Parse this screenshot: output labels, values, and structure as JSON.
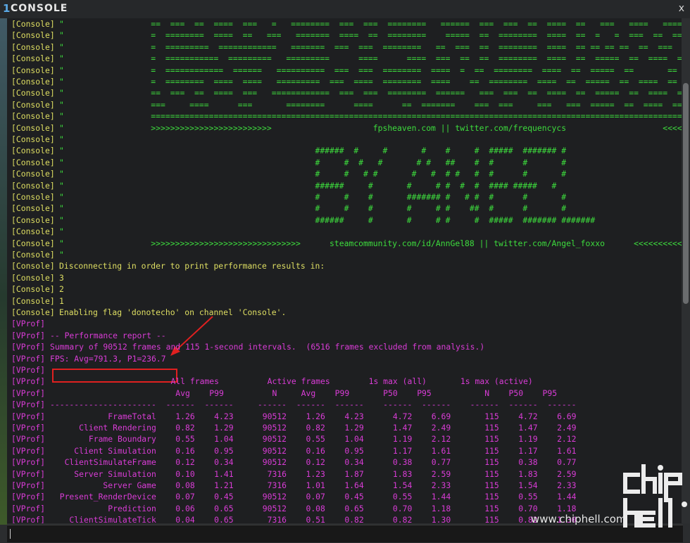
{
  "window": {
    "number": "1",
    "title": "CONSOLE",
    "close_label": "x"
  },
  "colors": {
    "console": "#dede62",
    "banner": "#3ddc3d",
    "vprof": "#d93cd6",
    "highlight": "#e02020",
    "background": "#1e1f21"
  },
  "prefixes": {
    "console": "[Console]",
    "vprof": "[VProf]"
  },
  "console_lines": [
    {
      "prefix": "[Console]",
      "text": "\"                  ==  ===  ==  ====  ===   =   ========  ===  ===  ========   ======  ===  ===  ==  ====  ==   ===   ====   ====",
      "color": "g"
    },
    {
      "prefix": "[Console]",
      "text": "\"                  =  ========  ====  ==   ===   =======  ====  ==  ========    =====  ==  ========  ====  ==  =   =  ===  ==  ===",
      "color": "g"
    },
    {
      "prefix": "[Console]",
      "text": "\"                  =  =========  ============   =======  ===  ===  ========   ==  ===  ==  ========  ====  == == == ==  ==  ===",
      "color": "g"
    },
    {
      "prefix": "[Console]",
      "text": "\"                  =  ===========  =========   =========      ====      ====  ===  ==  ==  ========  ====  ==  =====  ==  ====  ==",
      "color": "g"
    },
    {
      "prefix": "[Console]",
      "text": "\"                  =  ============  ======   ==========  ===  ===  ========  ====  =  ==  ========  ====  ==  =====  ==       ==",
      "color": "g"
    },
    {
      "prefix": "[Console]",
      "text": "\"                  =  ========  ====  ====   =========  ===  ====  ========  ====    ==  ========  ====  ==  =====  ==  ====  ==",
      "color": "g"
    },
    {
      "prefix": "[Console]",
      "text": "\"                  ==  ===  ==  ====  ===   ============  ===  ===  ========  ======   ===  ===  ==  ====  ==  =====  ==  ====  ==",
      "color": "g"
    },
    {
      "prefix": "[Console]",
      "text": "\"                  ===     ====      ===       ========      ====      ==  =======    ===  ===     ===   ===  =====  ==  ====  ==",
      "color": "g"
    },
    {
      "prefix": "[Console]",
      "text": "\"                  =====================================================================================================================",
      "color": "g"
    },
    {
      "prefix": "[Console]",
      "text": "\"                  >>>>>>>>>>>>>>>>>>>>>>>>>                     fpsheaven.com || twitter.com/frequencycs                    <<<<<<<<",
      "color": "g"
    },
    {
      "prefix": "[Console]",
      "text": "\"",
      "color": "g"
    },
    {
      "prefix": "[Console]",
      "text": "\"                                                    ######  #     #       #    #     #  #####  ####### #",
      "color": "g"
    },
    {
      "prefix": "[Console]",
      "text": "\"                                                    #     #  #   #       # #   ##    #  #      #       #",
      "color": "g"
    },
    {
      "prefix": "[Console]",
      "text": "\"                                                    #     #   # #       #   #  # #   #  #      #       #",
      "color": "g"
    },
    {
      "prefix": "[Console]",
      "text": "\"                                                    ######     #       #     # #  #  #  #### #####   #",
      "color": "g"
    },
    {
      "prefix": "[Console]",
      "text": "\"                                                    #     #    #       ####### #   # #  #      #       #",
      "color": "g"
    },
    {
      "prefix": "[Console]",
      "text": "\"                                                    #     #    #       #     # #    ##  #      #       #",
      "color": "g"
    },
    {
      "prefix": "[Console]",
      "text": "\"                                                    ######     #       #     # #     #  #####  ####### #######",
      "color": "g"
    },
    {
      "prefix": "[Console]",
      "text": "\"",
      "color": "g"
    },
    {
      "prefix": "[Console]",
      "text": "\"                  >>>>>>>>>>>>>>>>>>>>>>>>>>>>>>>      steamcommunity.com/id/AnnGel88 || twitter.com/Angel_foxxo      <<<<<<<<<<<<",
      "color": "g"
    },
    {
      "prefix": "[Console]",
      "text": "\"",
      "color": "g"
    },
    {
      "prefix": "[Console]",
      "text": "Disconnecting in order to print performance results in:",
      "color": "c"
    },
    {
      "prefix": "[Console]",
      "text": "3",
      "color": "c"
    },
    {
      "prefix": "[Console]",
      "text": "2",
      "color": "c"
    },
    {
      "prefix": "[Console]",
      "text": "1",
      "color": "c"
    },
    {
      "prefix": "[Console]",
      "text": "Enabling flag 'donotecho' on channel 'Console'.",
      "color": "c"
    }
  ],
  "vprof_lines": [
    "",
    "-- Performance report --",
    "Summary of 90512 frames and 115 1-second intervals.  (6516 frames excluded from analysis.)",
    "FPS: Avg=791.3, P1=236.7",
    "",
    "                         All frames          Active frames        1s max (all)       1s max (active)",
    "                          Avg    P99          N     Avg    P99       P50    P95           N    P50    P95",
    "----------------------  ------  ------     ------  ------  ------    ------  ------    ------  ------  ------",
    "            FrameTotal    1.26    4.23      90512    1.26    4.23      4.72    6.69       115    4.72    6.69",
    "      Client Rendering    0.82    1.29      90512    0.82    1.29      1.47    2.49       115    1.47    2.49",
    "        Frame Boundary    0.55    1.04      90512    0.55    1.04      1.19    2.12       115    1.19    2.12",
    "     Client Simulation    0.16    0.95      90512    0.16    0.95      1.17    1.61       115    1.17    1.61",
    "   ClientSimulateFrame    0.12    0.34      90512    0.12    0.34      0.38    0.77       115    0.38    0.77",
    "     Server Simulation    0.10    1.41       7316    1.23    1.87      1.83    2.59       115    1.83    2.59",
    "           Server Game    0.08    1.21       7316    1.01    1.64      1.54    2.33       115    1.54    2.33",
    "  Present_RenderDevice    0.07    0.45      90512    0.07    0.45      0.55    1.44       115    0.55    1.44",
    "            Prediction    0.06    0.65      90512    0.08    0.65      0.70    1.18       115    0.70    1.18",
    "    ClientSimulateTick    0.04    0.65       7316    0.51    0.82      0.82    1.30       115    0.82    1.30"
  ],
  "watermark": {
    "text": "www.chiphell.com"
  }
}
